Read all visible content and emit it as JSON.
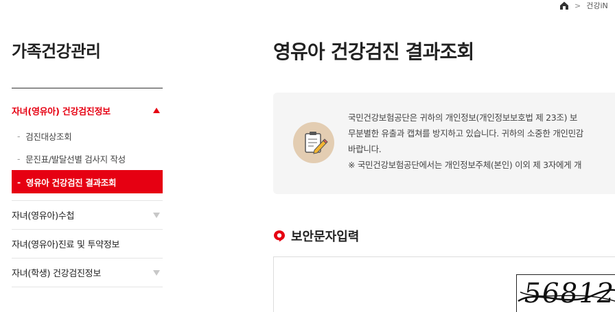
{
  "breadcrumb": {
    "current": "건강iN"
  },
  "sidebar": {
    "title": "가족건강관리",
    "menus": [
      {
        "label": "자녀(영유아) 건강검진정보",
        "expanded": true,
        "items": [
          {
            "label": "검진대상조회"
          },
          {
            "label": "문진표/발달선별 검사지 작성"
          },
          {
            "label": "영유아 건강검진 결과조회"
          }
        ]
      },
      {
        "label": "자녀(영유아)수첩"
      },
      {
        "label": "자녀(영유아)진료 및 투약정보"
      },
      {
        "label": "자녀(학생) 건강검진정보"
      }
    ]
  },
  "main": {
    "title": "영유아 건강검진 결과조회",
    "notice": {
      "line1": "국민건강보험공단은 귀하의 개인정보(개인정보보호법 제 23조) 보",
      "line2": "무분별한 유출과 캡쳐를 방지하고 있습니다. 귀하의 소중한 개인민감",
      "line3": "바랍니다.",
      "line4": "※ 국민건강보험공단에서는 개인정보주체(본인) 이외 제 3자에게 개"
    },
    "section_title": "보안문자입력",
    "captcha": {
      "text": "56812"
    }
  },
  "colors": {
    "accent": "#e60012",
    "notice_bg": "#f5f5f5",
    "icon_bg": "#e3cdb2"
  }
}
